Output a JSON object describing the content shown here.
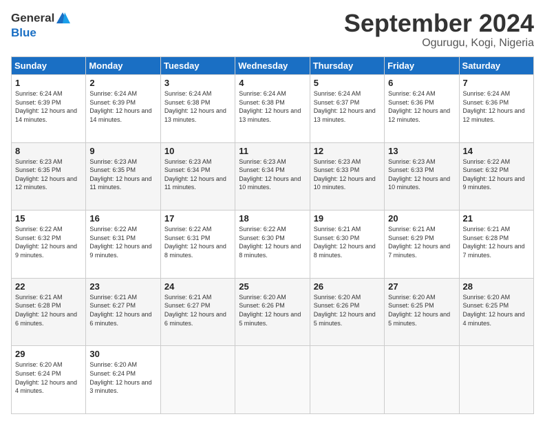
{
  "header": {
    "logo": {
      "line1": "General",
      "line2": "Blue"
    },
    "month": "September 2024",
    "location": "Ogurugu, Kogi, Nigeria"
  },
  "weekdays": [
    "Sunday",
    "Monday",
    "Tuesday",
    "Wednesday",
    "Thursday",
    "Friday",
    "Saturday"
  ],
  "weeks": [
    [
      {
        "day": "1",
        "sunrise": "6:24 AM",
        "sunset": "6:39 PM",
        "daylight": "12 hours and 14 minutes."
      },
      {
        "day": "2",
        "sunrise": "6:24 AM",
        "sunset": "6:39 PM",
        "daylight": "12 hours and 14 minutes."
      },
      {
        "day": "3",
        "sunrise": "6:24 AM",
        "sunset": "6:38 PM",
        "daylight": "12 hours and 13 minutes."
      },
      {
        "day": "4",
        "sunrise": "6:24 AM",
        "sunset": "6:38 PM",
        "daylight": "12 hours and 13 minutes."
      },
      {
        "day": "5",
        "sunrise": "6:24 AM",
        "sunset": "6:37 PM",
        "daylight": "12 hours and 13 minutes."
      },
      {
        "day": "6",
        "sunrise": "6:24 AM",
        "sunset": "6:36 PM",
        "daylight": "12 hours and 12 minutes."
      },
      {
        "day": "7",
        "sunrise": "6:24 AM",
        "sunset": "6:36 PM",
        "daylight": "12 hours and 12 minutes."
      }
    ],
    [
      {
        "day": "8",
        "sunrise": "6:23 AM",
        "sunset": "6:35 PM",
        "daylight": "12 hours and 12 minutes."
      },
      {
        "day": "9",
        "sunrise": "6:23 AM",
        "sunset": "6:35 PM",
        "daylight": "12 hours and 11 minutes."
      },
      {
        "day": "10",
        "sunrise": "6:23 AM",
        "sunset": "6:34 PM",
        "daylight": "12 hours and 11 minutes."
      },
      {
        "day": "11",
        "sunrise": "6:23 AM",
        "sunset": "6:34 PM",
        "daylight": "12 hours and 10 minutes."
      },
      {
        "day": "12",
        "sunrise": "6:23 AM",
        "sunset": "6:33 PM",
        "daylight": "12 hours and 10 minutes."
      },
      {
        "day": "13",
        "sunrise": "6:23 AM",
        "sunset": "6:33 PM",
        "daylight": "12 hours and 10 minutes."
      },
      {
        "day": "14",
        "sunrise": "6:22 AM",
        "sunset": "6:32 PM",
        "daylight": "12 hours and 9 minutes."
      }
    ],
    [
      {
        "day": "15",
        "sunrise": "6:22 AM",
        "sunset": "6:32 PM",
        "daylight": "12 hours and 9 minutes."
      },
      {
        "day": "16",
        "sunrise": "6:22 AM",
        "sunset": "6:31 PM",
        "daylight": "12 hours and 9 minutes."
      },
      {
        "day": "17",
        "sunrise": "6:22 AM",
        "sunset": "6:31 PM",
        "daylight": "12 hours and 8 minutes."
      },
      {
        "day": "18",
        "sunrise": "6:22 AM",
        "sunset": "6:30 PM",
        "daylight": "12 hours and 8 minutes."
      },
      {
        "day": "19",
        "sunrise": "6:21 AM",
        "sunset": "6:30 PM",
        "daylight": "12 hours and 8 minutes."
      },
      {
        "day": "20",
        "sunrise": "6:21 AM",
        "sunset": "6:29 PM",
        "daylight": "12 hours and 7 minutes."
      },
      {
        "day": "21",
        "sunrise": "6:21 AM",
        "sunset": "6:28 PM",
        "daylight": "12 hours and 7 minutes."
      }
    ],
    [
      {
        "day": "22",
        "sunrise": "6:21 AM",
        "sunset": "6:28 PM",
        "daylight": "12 hours and 6 minutes."
      },
      {
        "day": "23",
        "sunrise": "6:21 AM",
        "sunset": "6:27 PM",
        "daylight": "12 hours and 6 minutes."
      },
      {
        "day": "24",
        "sunrise": "6:21 AM",
        "sunset": "6:27 PM",
        "daylight": "12 hours and 6 minutes."
      },
      {
        "day": "25",
        "sunrise": "6:20 AM",
        "sunset": "6:26 PM",
        "daylight": "12 hours and 5 minutes."
      },
      {
        "day": "26",
        "sunrise": "6:20 AM",
        "sunset": "6:26 PM",
        "daylight": "12 hours and 5 minutes."
      },
      {
        "day": "27",
        "sunrise": "6:20 AM",
        "sunset": "6:25 PM",
        "daylight": "12 hours and 5 minutes."
      },
      {
        "day": "28",
        "sunrise": "6:20 AM",
        "sunset": "6:25 PM",
        "daylight": "12 hours and 4 minutes."
      }
    ],
    [
      {
        "day": "29",
        "sunrise": "6:20 AM",
        "sunset": "6:24 PM",
        "daylight": "12 hours and 4 minutes."
      },
      {
        "day": "30",
        "sunrise": "6:20 AM",
        "sunset": "6:24 PM",
        "daylight": "12 hours and 3 minutes."
      },
      null,
      null,
      null,
      null,
      null
    ]
  ]
}
